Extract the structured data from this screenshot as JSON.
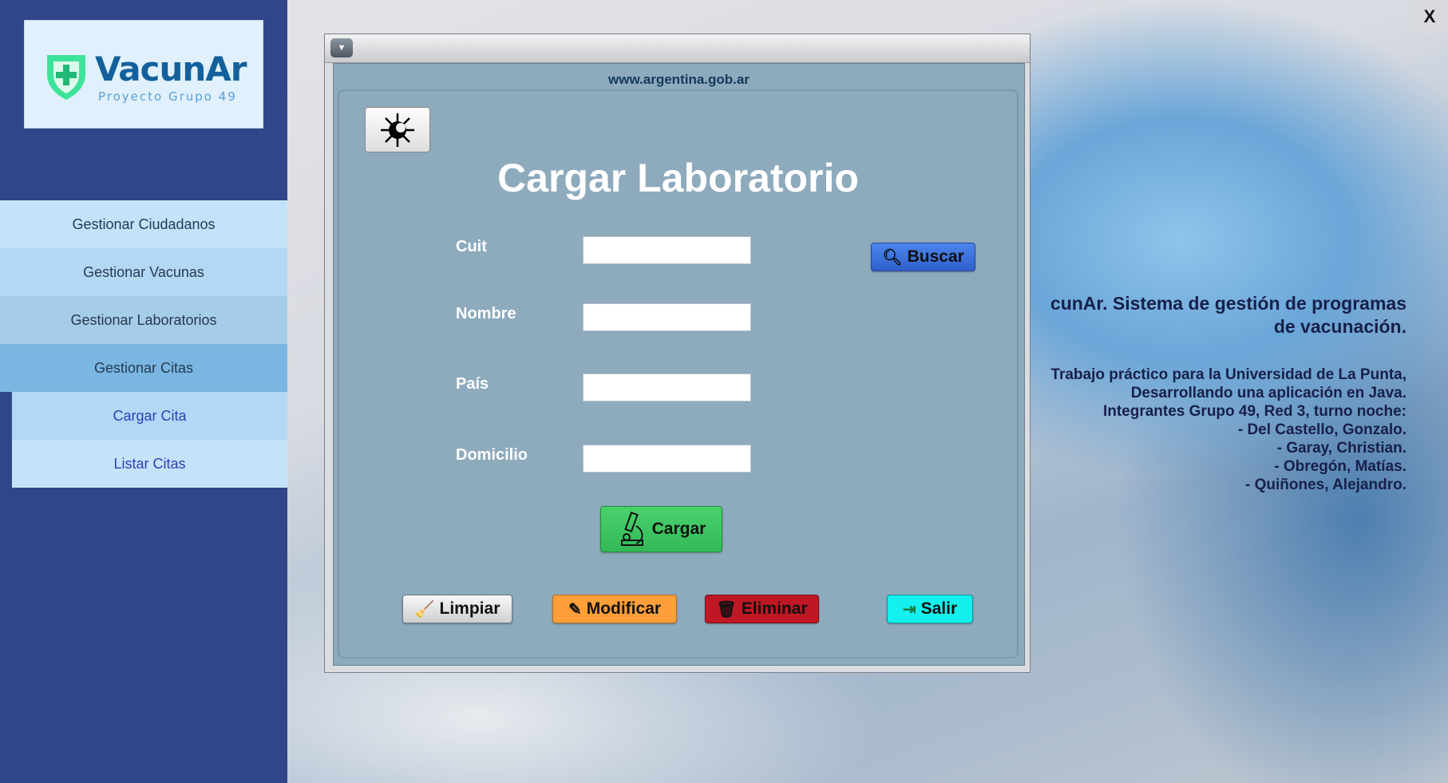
{
  "logo": {
    "name": "VacunAr",
    "subtitle": "Proyecto Grupo 49"
  },
  "sidebar": {
    "items": [
      {
        "label": "Gestionar Ciudadanos"
      },
      {
        "label": "Gestionar Vacunas"
      },
      {
        "label": "Gestionar Laboratorios"
      },
      {
        "label": "Gestionar Citas"
      },
      {
        "label": "Cargar Cita"
      },
      {
        "label": "Listar Citas"
      }
    ]
  },
  "window": {
    "close_label": "X"
  },
  "about": {
    "heading": [
      "cunAr. Sistema de gestión de programas",
      "de vacunación."
    ],
    "lines": [
      "Trabajo práctico para la Universidad de La Punta,",
      "Desarrollando una aplicación en Java.",
      "Integrantes Grupo 49, Red 3, turno noche:",
      "- Del Castello, Gonzalo.",
      "- Garay, Christian.",
      "- Obregón, Matías.",
      "- Quiñones, Alejandro."
    ]
  },
  "dialog": {
    "url": "www.argentina.gob.ar",
    "title": "Cargar Laboratorio",
    "fields": [
      {
        "label": "Cuit",
        "value": ""
      },
      {
        "label": "Nombre",
        "value": ""
      },
      {
        "label": "País",
        "value": ""
      },
      {
        "label": "Domicilio",
        "value": ""
      }
    ],
    "buttons": {
      "buscar": "Buscar",
      "cargar": "Cargar",
      "limpiar": "Limpiar",
      "modificar": "Modificar",
      "eliminar": "Eliminar",
      "salir": "Salir"
    }
  },
  "colors": {
    "sidebar": "#314688",
    "panel": "#8eaabd",
    "cargar": "#3ec964",
    "modificar": "#ff9f3a",
    "eliminar": "#bf1724",
    "salir": "#14f0ee",
    "buscar": "#3a6fdb"
  }
}
